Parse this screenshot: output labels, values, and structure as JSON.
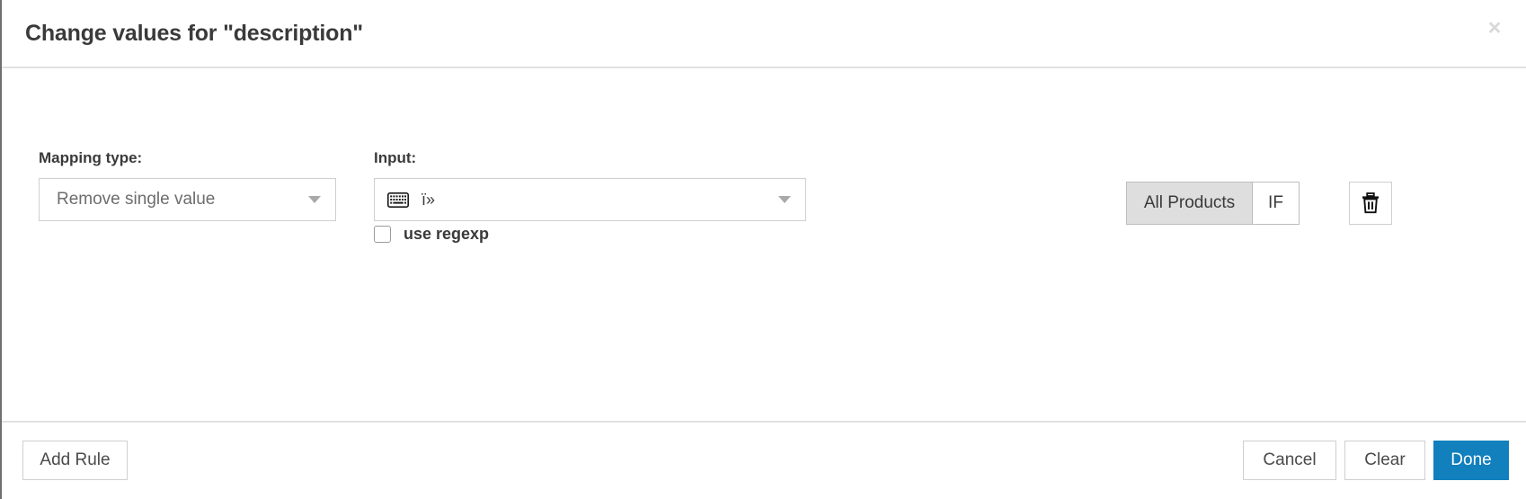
{
  "dialog": {
    "title": "Change values for \"description\"",
    "close_label": "×",
    "close_icon": "close-icon"
  },
  "rule": {
    "mapping": {
      "label": "Mapping type:",
      "selected": "Remove single value",
      "caret_icon": "chevron-down-icon"
    },
    "input": {
      "label": "Input:",
      "value": "ï»",
      "keyboard_icon": "keyboard-icon",
      "caret_icon": "chevron-down-icon"
    },
    "regexp": {
      "label": "use regexp",
      "checked": false
    },
    "scope": {
      "all_products_label": "All Products",
      "if_label": "IF",
      "active": "All Products"
    },
    "delete": {
      "icon": "trash-icon"
    }
  },
  "footer": {
    "add_rule_label": "Add Rule",
    "cancel_label": "Cancel",
    "clear_label": "Clear",
    "done_label": "Done"
  },
  "colors": {
    "primary": "#1180bd",
    "active_segment": "#dedede",
    "border": "#cfcfcf",
    "text": "#3a3a3a"
  }
}
